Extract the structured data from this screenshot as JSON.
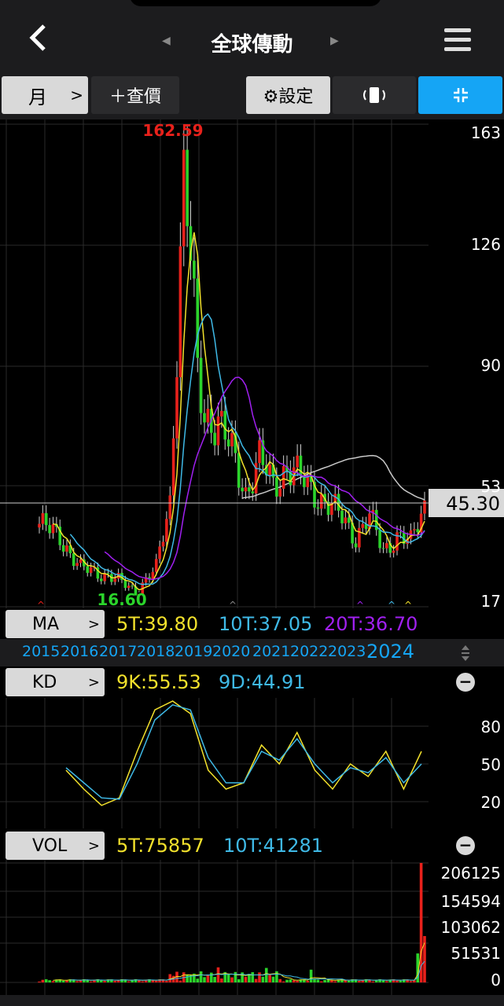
{
  "header": {
    "title": "全球傳動",
    "back_icon": "chevron-left-icon",
    "menu_icon": "hamburger-icon"
  },
  "toolbar": {
    "period": "月",
    "add_quote": "＋查價",
    "settings": "⚙設定",
    "rotate_icon": "rotate-icon",
    "fullscreen_icon": "collapse-icon"
  },
  "price_chart": {
    "y_ticks": [
      "163",
      "126",
      "90",
      "53",
      "17"
    ],
    "high_label": "162.59",
    "low_label": "16.60",
    "current_price": "45.30"
  },
  "ma": {
    "button": "MA",
    "v5": "5T:39.80",
    "v10": "10T:37.05",
    "v20": "20T:36.70"
  },
  "years": [
    "2015",
    "2016",
    "2017",
    "2018",
    "2019",
    "2020",
    "2021",
    "2022",
    "2023",
    "2024"
  ],
  "kd": {
    "button": "KD",
    "k": "9K:55.53",
    "d": "9D:44.91",
    "y_ticks": [
      "80",
      "50",
      "20"
    ]
  },
  "vol": {
    "button": "VOL",
    "v5": "5T:75857",
    "v10": "10T:41281",
    "y_ticks": [
      "206125",
      "154594",
      "103062",
      "51531",
      "0"
    ]
  },
  "colors": {
    "up": "#e8211b",
    "down": "#2bd42b",
    "ma5": "#f2e12c",
    "ma10": "#3fb9e6",
    "ma20": "#a020f0",
    "ma60": "#c8c8c8",
    "accent": "#15a5f5"
  },
  "chart_data": [
    {
      "type": "candlestick",
      "title": "全球傳動",
      "period": "monthly",
      "x": [
        "2015",
        "2016",
        "2017",
        "2018",
        "2019",
        "2020",
        "2021",
        "2022",
        "2023",
        "2024"
      ],
      "close_by_year": [
        38,
        24,
        19,
        36,
        115,
        70,
        58,
        50,
        36,
        45.3
      ],
      "ylim": [
        17,
        163
      ],
      "max": 162.59,
      "min": 16.6,
      "last": 45.3,
      "series": [
        {
          "name": "5T",
          "last": 39.8
        },
        {
          "name": "10T",
          "last": 37.05
        },
        {
          "name": "20T",
          "last": 36.7
        }
      ]
    },
    {
      "type": "line",
      "series": [
        {
          "name": "9K",
          "last": 55.53,
          "values": [
            40,
            25,
            12,
            18,
            55,
            88,
            95,
            85,
            40,
            25,
            30,
            60,
            45,
            70,
            40,
            25,
            45,
            35,
            55,
            25,
            55
          ]
        },
        {
          "name": "9D",
          "last": 44.91,
          "values": [
            42,
            30,
            18,
            17,
            45,
            80,
            92,
            88,
            50,
            30,
            30,
            55,
            48,
            65,
            45,
            30,
            42,
            38,
            50,
            30,
            45
          ]
        }
      ],
      "ylim": [
        0,
        100
      ]
    },
    {
      "type": "bar",
      "series": [
        {
          "name": "5T",
          "last": 75857
        },
        {
          "name": "10T",
          "last": 41281
        }
      ],
      "ylim": [
        0,
        206125
      ]
    }
  ]
}
